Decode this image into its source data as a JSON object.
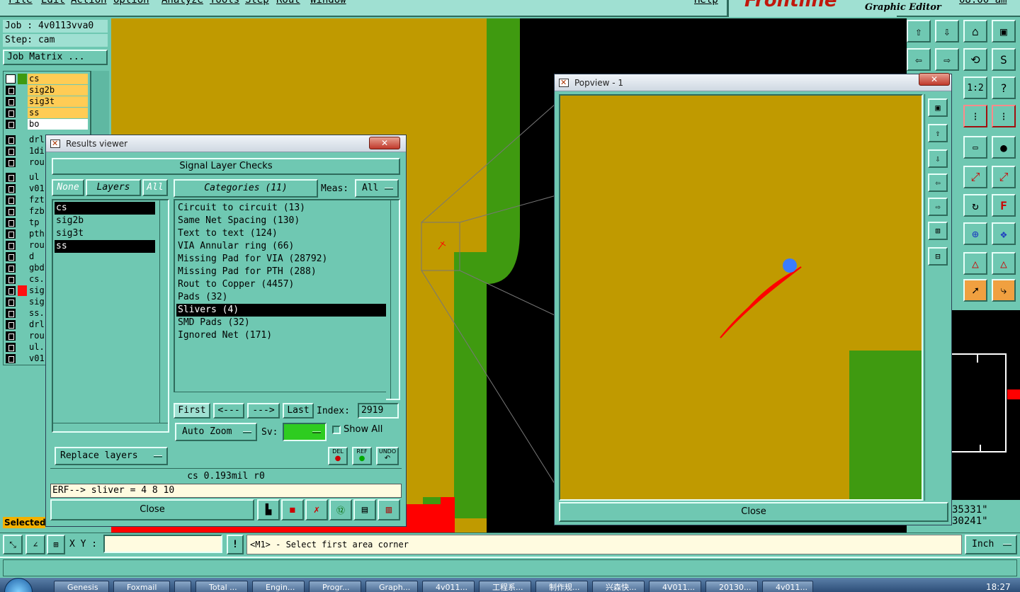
{
  "menubar": {
    "items": [
      "File",
      "Edit",
      "Action",
      "Option",
      "Analyze",
      "Tools",
      "Step",
      "Rout",
      "Window"
    ],
    "help": "Help",
    "clock_top": "08:00 am"
  },
  "logo": {
    "brand": "Frontline",
    "subtitle": "Graphic Editor"
  },
  "job": {
    "job_label": "Job : 4v0113vva0",
    "step_label": "Step: cam",
    "matrix_button": "Job Matrix ..."
  },
  "layers": [
    {
      "name": "cs",
      "state": "work"
    },
    {
      "name": "sig2b",
      "state": "display"
    },
    {
      "name": "sig3t",
      "state": "display"
    },
    {
      "name": "ss",
      "state": "display"
    },
    {
      "name": "bo",
      "state": "white"
    },
    {
      "name": "drl",
      "state": "none"
    },
    {
      "name": "1di",
      "state": "none"
    },
    {
      "name": "rou",
      "state": "none"
    },
    {
      "name": "ul",
      "state": "none"
    },
    {
      "name": "v01",
      "state": "none"
    },
    {
      "name": "fzt",
      "state": "none"
    },
    {
      "name": "fzb",
      "state": "none"
    },
    {
      "name": "tp",
      "state": "none"
    },
    {
      "name": "pth",
      "state": "none"
    },
    {
      "name": "rou",
      "state": "none"
    },
    {
      "name": "d",
      "state": "none"
    },
    {
      "name": "gbd",
      "state": "none"
    },
    {
      "name": "cs.",
      "state": "none"
    },
    {
      "name": "sig",
      "state": "red"
    },
    {
      "name": "sig",
      "state": "none"
    },
    {
      "name": "ss.",
      "state": "none"
    },
    {
      "name": "drl",
      "state": "none"
    },
    {
      "name": "rou",
      "state": "none"
    },
    {
      "name": "ul.",
      "state": "none"
    },
    {
      "name": "v01",
      "state": "none"
    }
  ],
  "left_status": "Selected",
  "results_viewer": {
    "title": "Results viewer",
    "close_glyph": "✕",
    "header": "Signal Layer Checks",
    "none_btn": "None",
    "layers_btn": "Layers",
    "all_btn": "All",
    "layers": [
      {
        "name": "cs",
        "selected": true
      },
      {
        "name": "sig2b",
        "selected": false
      },
      {
        "name": "sig3t",
        "selected": false
      },
      {
        "name": "ss",
        "selected": true
      }
    ],
    "categories_btn": "Categories (11)",
    "meas_label": "Meas:",
    "meas_value": "All",
    "categories": [
      {
        "label": "Circuit to circuit (13)",
        "selected": false
      },
      {
        "label": "Same Net Spacing (130)",
        "selected": false
      },
      {
        "label": "Text to text (124)",
        "selected": false
      },
      {
        "label": "VIA Annular ring (66)",
        "selected": false
      },
      {
        "label": "Missing Pad for VIA (28792)",
        "selected": false
      },
      {
        "label": "Missing Pad for PTH (288)",
        "selected": false
      },
      {
        "label": "Rout to Copper (4457)",
        "selected": false
      },
      {
        "label": "Pads (32)",
        "selected": false
      },
      {
        "label": "Slivers (4)",
        "selected": true
      },
      {
        "label": "SMD Pads (32)",
        "selected": false
      },
      {
        "label": "Ignored Net (171)",
        "selected": false
      }
    ],
    "first_btn": "First",
    "prev_btn": "<---",
    "next_btn": "--->",
    "last_btn": "Last",
    "index_label": "Index:",
    "index_value": "2919",
    "autozoom_btn": "Auto Zoom",
    "sv_label": "Sv:",
    "show_all_label": "Show All",
    "replace_btn": "Replace layers",
    "del_btn": "DEL",
    "ref_btn": "REF",
    "undo_btn": "UNDO",
    "status_line": "cs 0.193mil  r0",
    "erf_line": "ERF--> sliver = 4 8 10",
    "close_btn": "Close"
  },
  "popview": {
    "title": "Popview - 1",
    "close_glyph": "✕",
    "close_btn": "Close"
  },
  "coords": {
    "x": "35331\"",
    "y": "30241\""
  },
  "bottombar": {
    "xy_label": "X Y :",
    "xy_value": "",
    "warn_glyph": "!",
    "prompt": "<M1> - Select first area corner",
    "unit": "Inch"
  },
  "taskbar": {
    "items": [
      "Genesis",
      "Foxmail",
      "",
      "Total ...",
      "Engin...",
      "Progr...",
      "Graph...",
      "4v011...",
      "工程系...",
      "制作规...",
      "兴森快...",
      "4V011...",
      "20130...",
      "4v011..."
    ],
    "clock": "18:27"
  },
  "colors": {
    "copper": "#c09a00",
    "green": "#3f9a10",
    "teal": "#6fc8b2",
    "sliver": "#ff0000",
    "marker": "#3a7cff"
  }
}
